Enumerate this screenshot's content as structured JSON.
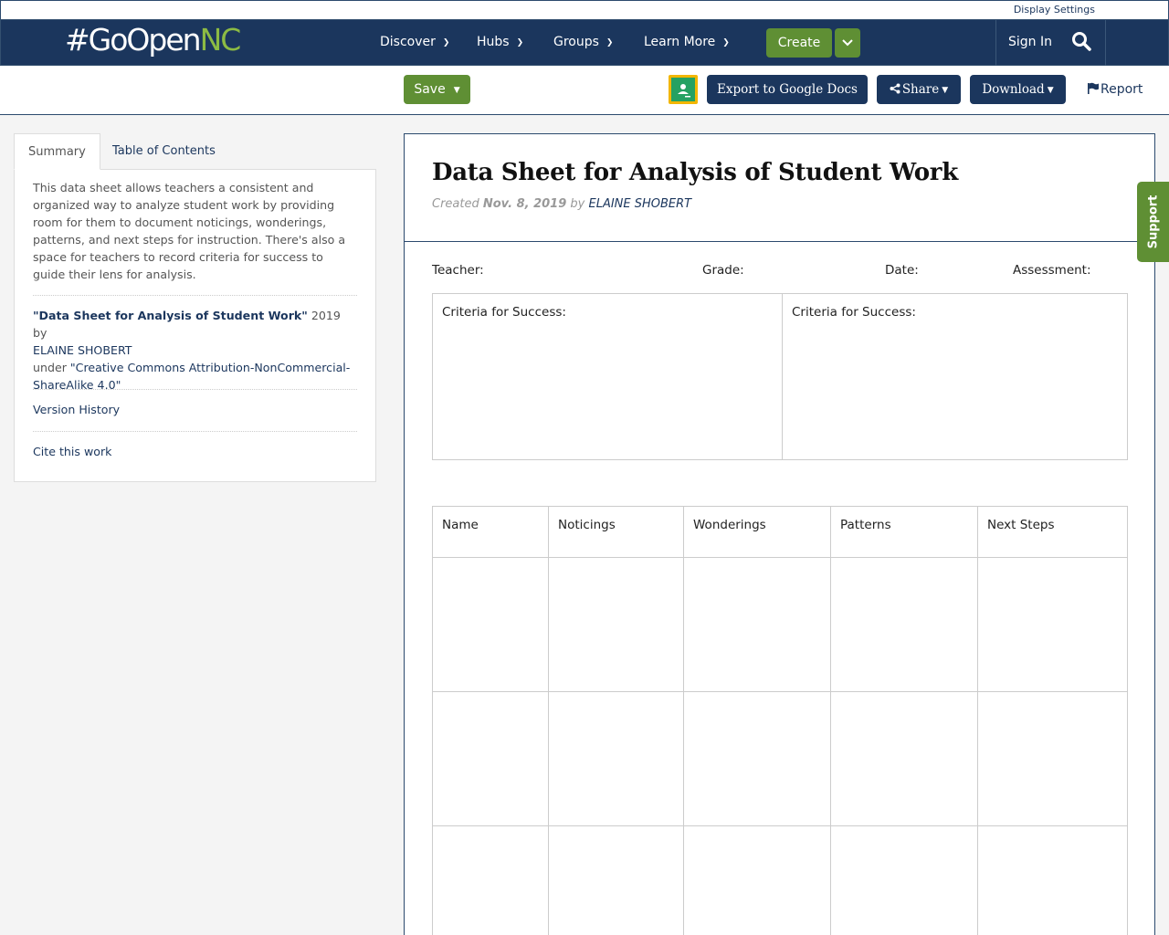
{
  "util": {
    "display_settings": "Display Settings"
  },
  "brand": {
    "prefix": "#GoOpen",
    "suffix": "NC"
  },
  "nav": {
    "discover": "Discover",
    "hubs": "Hubs",
    "groups": "Groups",
    "learn_more": "Learn More",
    "create": "Create",
    "sign_in": "Sign In"
  },
  "actions": {
    "save": "Save",
    "export": "Export to Google Docs",
    "share": "Share",
    "download": "Download",
    "report": "Report"
  },
  "sidebar": {
    "tabs": [
      "Summary",
      "Table of Contents"
    ],
    "description": "This data sheet allows teachers a consistent and organized way to analyze student work by providing room for them to document noticings, wonderings, patterns, and next steps for instruction. There's also a space for teachers to record criteria for success to guide their lens for analysis.",
    "attribution": {
      "title": "\"Data Sheet for Analysis of Student Work\"",
      "year_by": " 2019 by",
      "author": "ELAINE SHOBERT",
      "under": "under ",
      "license": "\"Creative Commons Attribution-NonCommercial-ShareAlike 4.0\""
    },
    "version_history": "Version History",
    "cite": "Cite this work"
  },
  "document": {
    "title": "Data Sheet for Analysis of Student Work",
    "created_label": "Created",
    "created_date": "Nov. 8, 2019",
    "by": "by",
    "author": "ELAINE SHOBERT",
    "fields": {
      "teacher": "Teacher:",
      "grade": "Grade:",
      "date": "Date:",
      "assessment": "Assessment:"
    },
    "criteria": [
      "Criteria for Success:",
      "Criteria for Success:"
    ],
    "columns": [
      "Name",
      "Noticings",
      "Wonderings",
      "Patterns",
      "Next Steps"
    ]
  },
  "support": "Support",
  "colors": {
    "navy": "#1b365d",
    "green": "#5f8f34",
    "accent_green": "#8cbb44"
  }
}
